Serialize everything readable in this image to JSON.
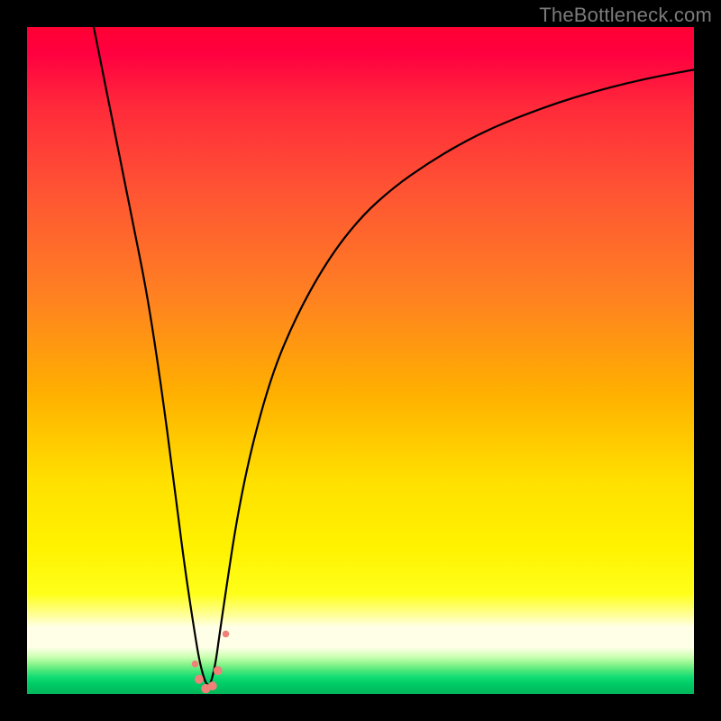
{
  "watermark": {
    "text": "TheBottleneck.com"
  },
  "chart_data": {
    "type": "line",
    "title": "",
    "xlabel": "",
    "ylabel": "",
    "xlim": [
      0,
      100
    ],
    "ylim": [
      0,
      100
    ],
    "grid": false,
    "legend": null,
    "background_bands_note": "vertical rainbow gradient red→yellow→pale→green, representing bottleneck score (red high, green low)",
    "series": [
      {
        "name": "bottleneck-curve",
        "color": "#000000",
        "x": [
          10,
          12,
          14,
          16,
          18,
          20,
          22,
          23.5,
          25,
          26,
          27.2,
          28.2,
          29,
          32,
          36,
          40,
          45,
          50,
          55,
          60,
          65,
          70,
          75,
          80,
          85,
          90,
          95,
          100
        ],
        "y": [
          100,
          90,
          80,
          70,
          60,
          47,
          32,
          20,
          10,
          4,
          0.5,
          4,
          10,
          30,
          46,
          56,
          65,
          71.5,
          76,
          79.5,
          82.5,
          85,
          87,
          88.8,
          90.3,
          91.6,
          92.7,
          93.6
        ]
      }
    ],
    "markers": [
      {
        "x": 25.2,
        "y": 4.5,
        "r": 3.8,
        "color": "#f08078"
      },
      {
        "x": 25.8,
        "y": 2.2,
        "r": 5.0,
        "color": "#f08078"
      },
      {
        "x": 26.8,
        "y": 0.8,
        "r": 5.2,
        "color": "#f08078"
      },
      {
        "x": 27.8,
        "y": 1.2,
        "r": 5.0,
        "color": "#f08078"
      },
      {
        "x": 28.6,
        "y": 3.5,
        "r": 5.0,
        "color": "#f08078"
      },
      {
        "x": 29.8,
        "y": 9.0,
        "r": 3.8,
        "color": "#f08078"
      }
    ]
  }
}
